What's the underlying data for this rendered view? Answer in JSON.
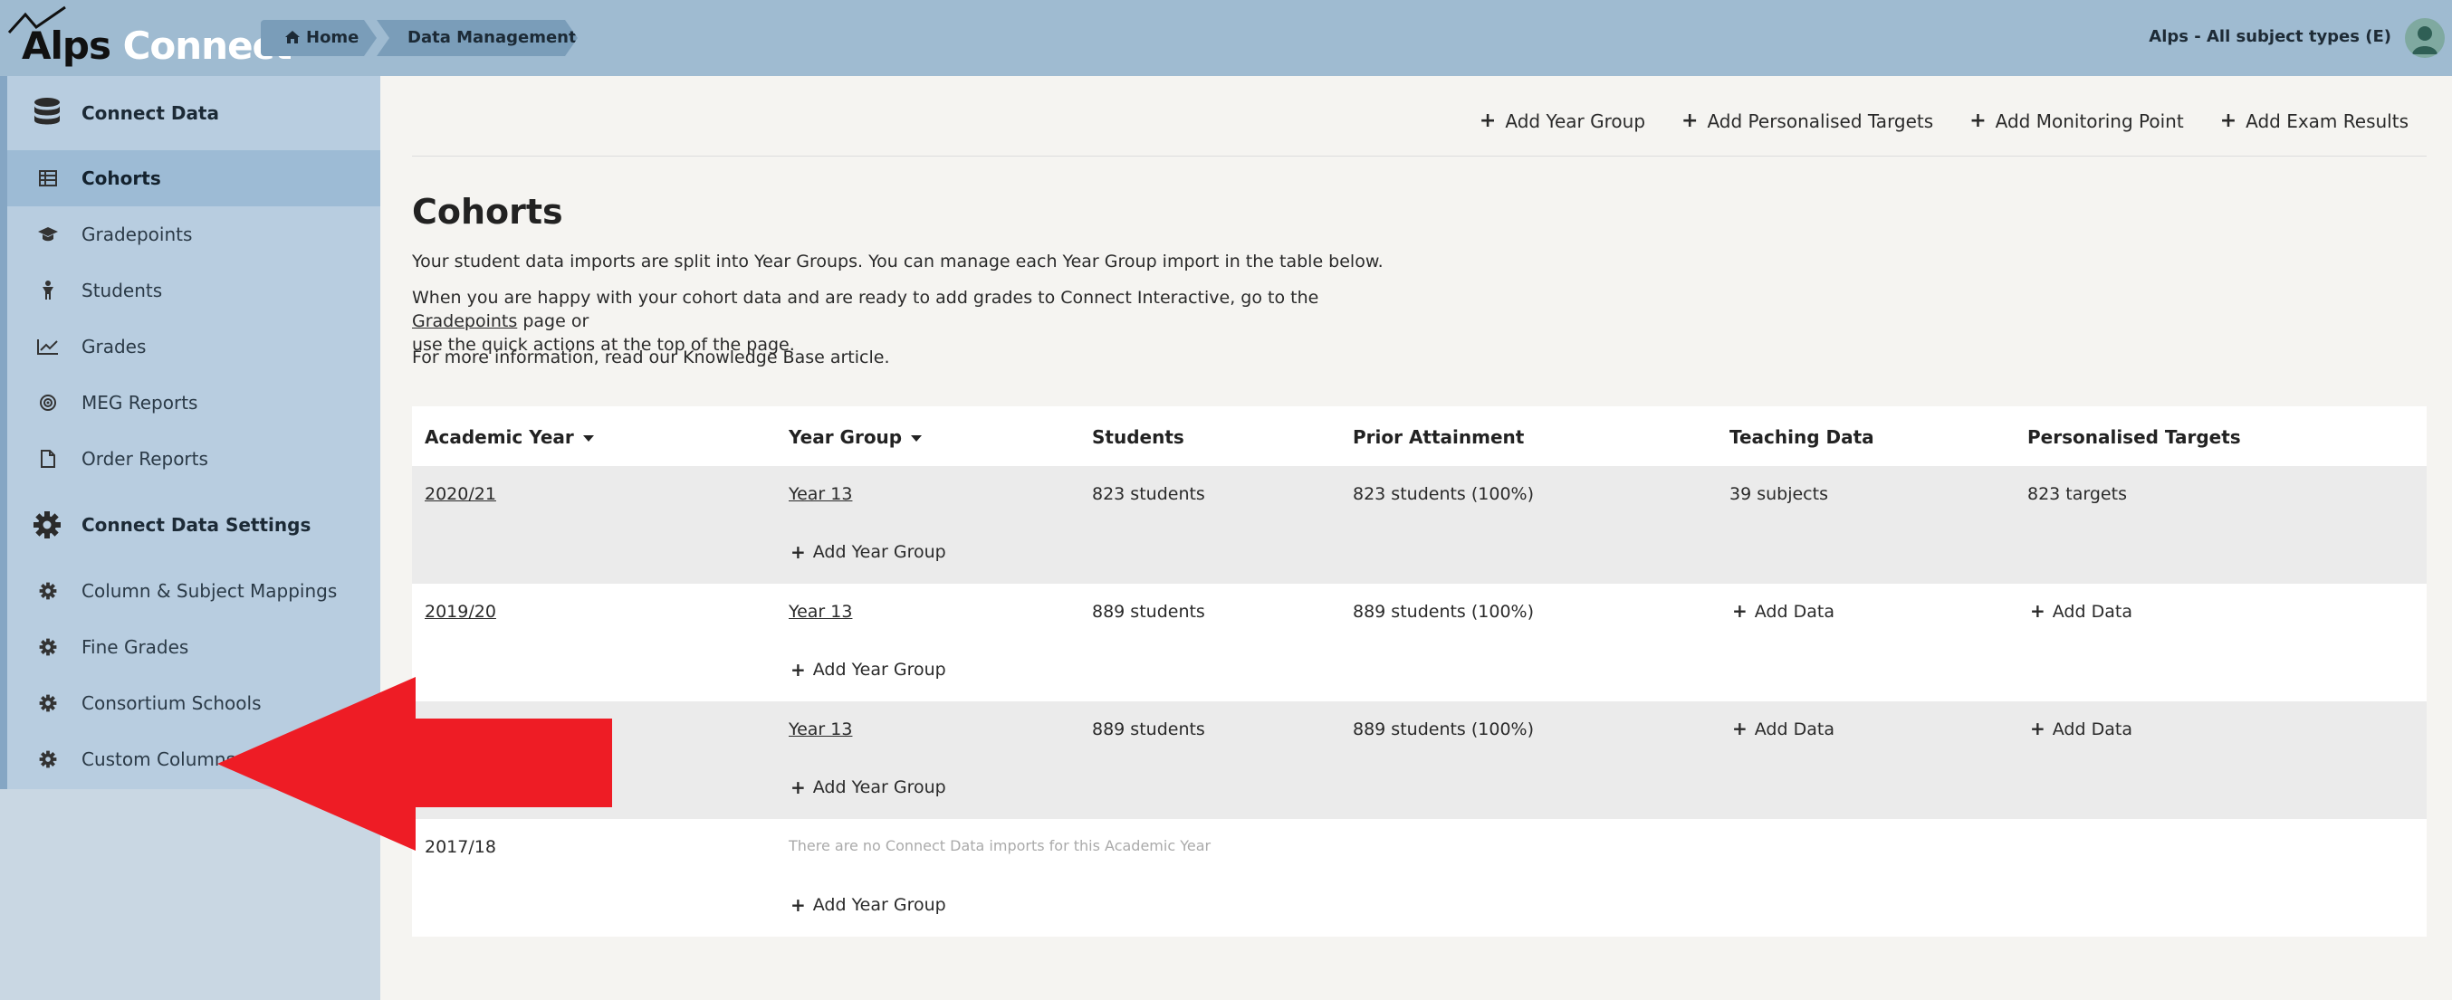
{
  "header": {
    "logo_alps": "Alps",
    "logo_connect": "Connect",
    "breadcrumbs": [
      "Home",
      "Data Management"
    ],
    "account_label": "Alps - All subject types (E)"
  },
  "sidebar": {
    "items": [
      {
        "label": "Connect Data",
        "icon": "database-icon",
        "type": "section"
      },
      {
        "label": "Cohorts",
        "icon": "table-icon",
        "type": "item",
        "active": true
      },
      {
        "label": "Gradepoints",
        "icon": "graduation-cap-icon",
        "type": "item"
      },
      {
        "label": "Students",
        "icon": "child-icon",
        "type": "item"
      },
      {
        "label": "Grades",
        "icon": "line-chart-icon",
        "type": "item"
      },
      {
        "label": "MEG Reports",
        "icon": "bullseye-icon",
        "type": "item"
      },
      {
        "label": "Order Reports",
        "icon": "file-icon",
        "type": "item"
      },
      {
        "label": "Connect Data Settings",
        "icon": "gear-icon",
        "type": "section"
      },
      {
        "label": "Column & Subject Mappings",
        "icon": "gear-icon",
        "type": "item"
      },
      {
        "label": "Fine Grades",
        "icon": "gear-icon",
        "type": "item"
      },
      {
        "label": "Consortium Schools",
        "icon": "gear-icon",
        "type": "item"
      },
      {
        "label": "Custom Columns",
        "icon": "gear-icon",
        "type": "item"
      }
    ]
  },
  "actions": [
    "Add Year Group",
    "Add Personalised Targets",
    "Add Monitoring Point",
    "Add Exam Results"
  ],
  "main": {
    "title": "Cohorts",
    "para1": "Your student data imports are split into Year Groups. You can manage each Year Group import in the table below.",
    "para2_before": "When you are happy with your cohort data and are ready to add grades to Connect Interactive, go to the ",
    "para2_link": "Gradepoints",
    "para2_after_line1": " page or",
    "para2_line2": "use the quick actions at the top of the page.",
    "para3": "For more information, read our Knowledge Base article."
  },
  "table": {
    "headers": [
      "Academic Year",
      "Year Group",
      "Students",
      "Prior Attainment",
      "Teaching Data",
      "Personalised Targets"
    ],
    "rows": [
      {
        "year": "2020/21",
        "group": "Year 13",
        "students": "823 students",
        "prior": "823 students (100%)",
        "teaching": "39 subjects",
        "targets": "823 targets",
        "add": "Add Year Group"
      },
      {
        "year": "2019/20",
        "group": "Year 13",
        "students": "889 students",
        "prior": "889 students (100%)",
        "teaching": "Add Data",
        "targets": "Add Data",
        "add": "Add Year Group"
      },
      {
        "year": "",
        "group": "Year 13",
        "students": "889 students",
        "prior": "889 students (100%)",
        "teaching": "Add Data",
        "targets": "Add Data",
        "add": "Add Year Group"
      },
      {
        "year": "2017/18",
        "empty_note": "There are no Connect Data imports for this Academic Year",
        "add": "Add Year Group"
      }
    ]
  },
  "colors": {
    "topbar": "#9fbbd1",
    "sidebar": "#b8cde0",
    "sidebar_active": "#9dbbd5",
    "arrow": "#ee1c25"
  }
}
